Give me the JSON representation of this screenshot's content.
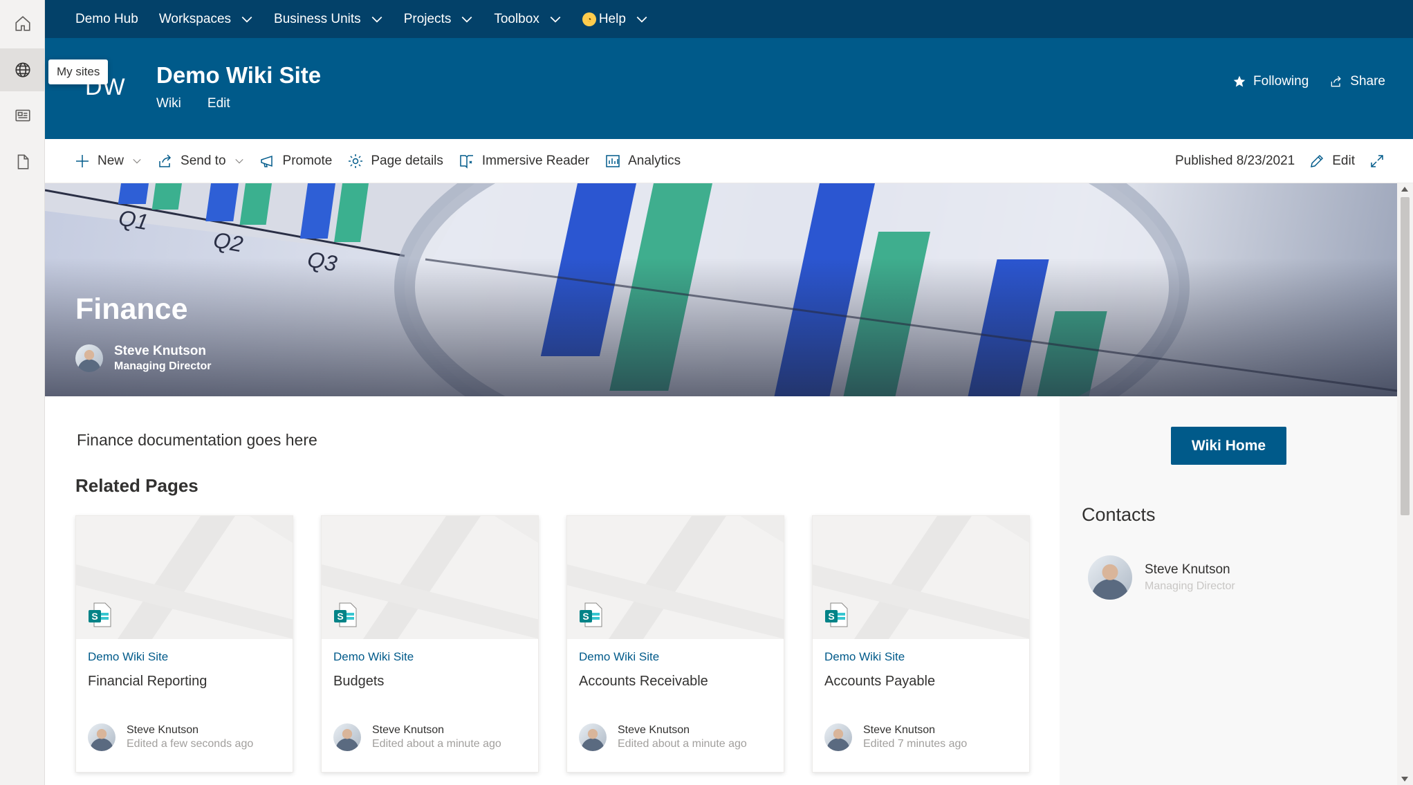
{
  "app_bar": {
    "tooltip": "My sites",
    "items": [
      "home-icon",
      "globe-icon",
      "news-icon",
      "document-icon"
    ]
  },
  "hub_nav": {
    "home": "Demo Hub",
    "items": [
      {
        "label": "Workspaces"
      },
      {
        "label": "Business Units"
      },
      {
        "label": "Projects"
      },
      {
        "label": "Toolbox"
      },
      {
        "label": "Help"
      }
    ]
  },
  "site": {
    "logo": "DW",
    "title": "Demo Wiki Site",
    "links": [
      "Wiki",
      "Edit"
    ],
    "following": "Following",
    "share": "Share"
  },
  "command_bar": {
    "new": "New",
    "send_to": "Send to",
    "promote": "Promote",
    "page_details": "Page details",
    "immersive_reader": "Immersive Reader",
    "analytics": "Analytics",
    "published": "Published 8/23/2021",
    "edit": "Edit"
  },
  "hero": {
    "title": "Finance",
    "author_name": "Steve Knutson",
    "author_role": "Managing Director",
    "chart_labels": [
      "Q1",
      "Q2",
      "Q3"
    ]
  },
  "main": {
    "intro": "Finance documentation goes here",
    "related_title": "Related Pages",
    "cards": [
      {
        "site": "Demo Wiki Site",
        "title": "Financial Reporting",
        "author": "Steve Knutson",
        "edited": "Edited a few seconds ago"
      },
      {
        "site": "Demo Wiki Site",
        "title": "Budgets",
        "author": "Steve Knutson",
        "edited": "Edited about a minute ago"
      },
      {
        "site": "Demo Wiki Site",
        "title": "Accounts Receivable",
        "author": "Steve Knutson",
        "edited": "Edited about a minute ago"
      },
      {
        "site": "Demo Wiki Site",
        "title": "Accounts Payable",
        "author": "Steve Knutson",
        "edited": "Edited 7 minutes ago"
      }
    ]
  },
  "side": {
    "wiki_home": "Wiki Home",
    "contacts_title": "Contacts",
    "contact_name": "Steve Knutson",
    "contact_role": "Managing Director"
  },
  "colors": {
    "hub_nav": "#034169",
    "header": "#005a8a",
    "accent": "#005a8a"
  }
}
